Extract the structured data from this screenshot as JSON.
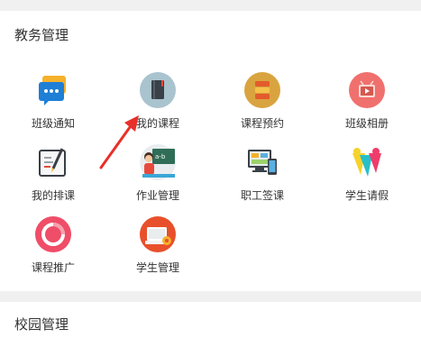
{
  "sections": {
    "teaching": {
      "title": "教务管理"
    },
    "campus": {
      "title": "校园管理"
    }
  },
  "items": [
    {
      "label": "班级通知",
      "icon": "chat-bubble-icon"
    },
    {
      "label": "我的课程",
      "icon": "book-icon"
    },
    {
      "label": "课程预约",
      "icon": "calendar-stack-icon"
    },
    {
      "label": "班级相册",
      "icon": "photo-album-icon"
    },
    {
      "label": "我的排课",
      "icon": "schedule-pen-icon"
    },
    {
      "label": "作业管理",
      "icon": "teacher-blackboard-icon"
    },
    {
      "label": "职工签课",
      "icon": "computer-phone-icon"
    },
    {
      "label": "学生请假",
      "icon": "colorful-shapes-icon"
    },
    {
      "label": "课程推广",
      "icon": "promotion-ring-icon"
    },
    {
      "label": "学生管理",
      "icon": "student-keyboard-icon"
    }
  ],
  "colors": {
    "background": "#f0f0f0",
    "panel": "#ffffff",
    "text": "#333333",
    "arrow": "#e8302a"
  }
}
